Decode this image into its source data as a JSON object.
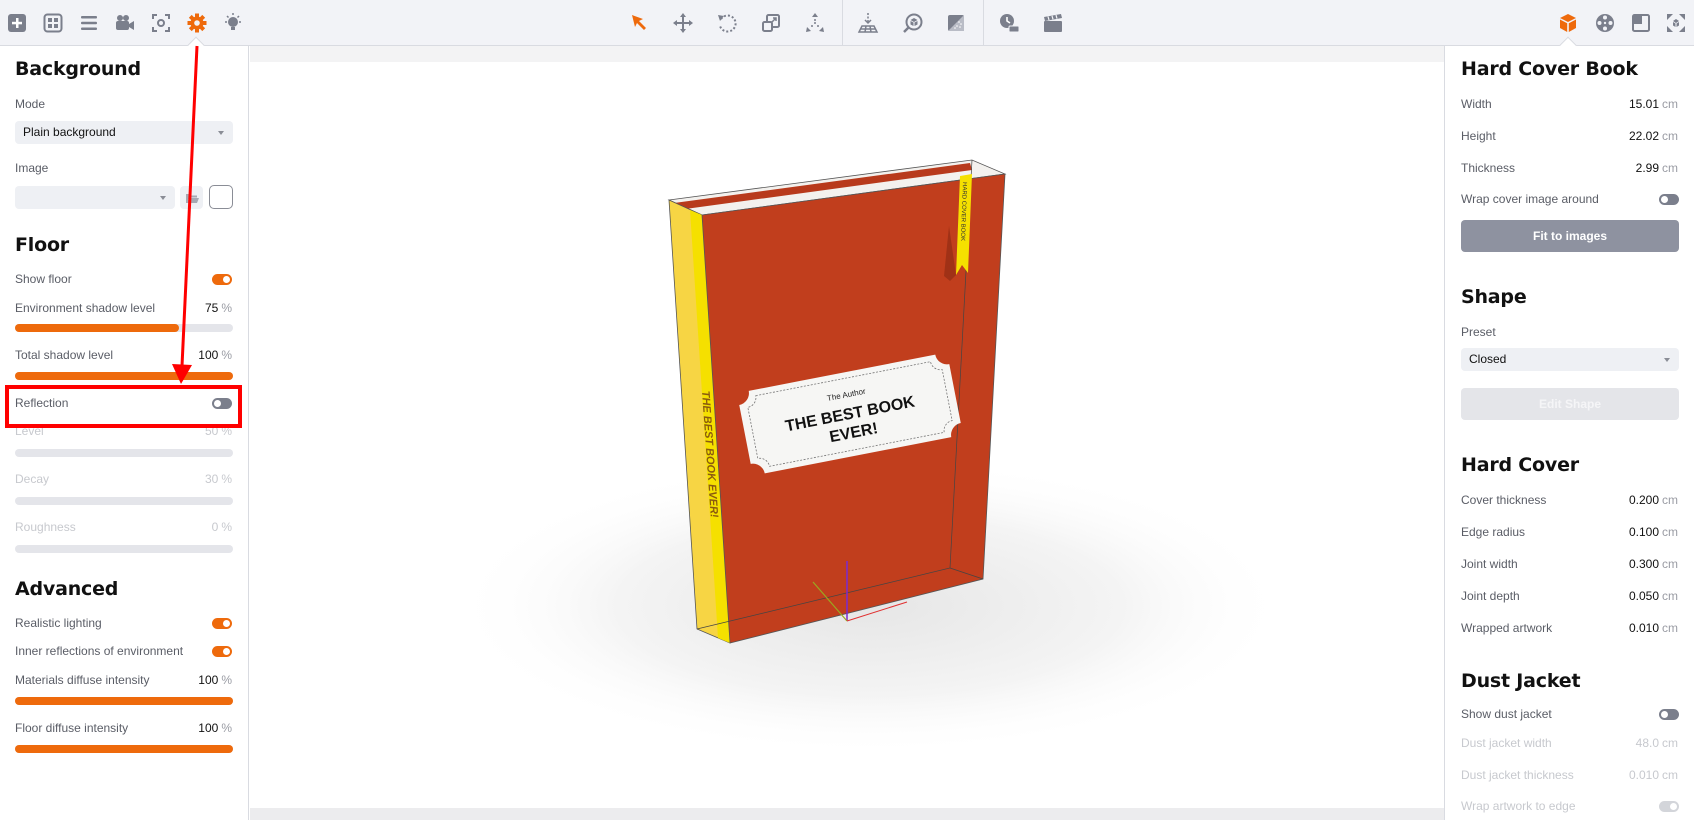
{
  "toolbar": {
    "left_icons": [
      {
        "name": "add-icon",
        "active": false
      },
      {
        "name": "grid-icon",
        "active": false
      },
      {
        "name": "list-icon",
        "active": false
      },
      {
        "name": "camera-icon",
        "active": false
      },
      {
        "name": "focus-icon",
        "active": false
      },
      {
        "name": "gear-icon",
        "active": true
      },
      {
        "name": "light-icon",
        "active": false
      }
    ],
    "center_icons": [
      {
        "name": "select-arrow-icon",
        "active": true
      },
      {
        "name": "move-icon",
        "active": false
      },
      {
        "name": "rotate-icon",
        "active": false
      },
      {
        "name": "scale-icon",
        "active": false
      },
      {
        "name": "axes-icon",
        "active": false
      },
      {
        "name": "drop-to-floor-icon",
        "active": false
      },
      {
        "name": "zoom-object-icon",
        "active": false
      },
      {
        "name": "material-icon",
        "active": false
      },
      {
        "name": "timer-icon",
        "active": false
      },
      {
        "name": "clapperboard-icon",
        "active": false
      }
    ],
    "right_icons": [
      {
        "name": "object-cube-icon",
        "active": true
      },
      {
        "name": "film-reel-icon",
        "active": false
      },
      {
        "name": "layout-icon",
        "active": false
      },
      {
        "name": "fullscreen-icon",
        "active": false
      }
    ],
    "accent_color": "#ee6a0c"
  },
  "left_panel": {
    "background": {
      "title": "Background",
      "mode_label": "Mode",
      "mode_value": "Plain background",
      "image_label": "Image",
      "image_value": ""
    },
    "floor": {
      "title": "Floor",
      "show_floor_label": "Show floor",
      "show_floor": true,
      "env_shadow_label": "Environment shadow level",
      "env_shadow_value": "75",
      "env_shadow_pct": 75,
      "total_shadow_label": "Total shadow level",
      "total_shadow_value": "100",
      "total_shadow_pct": 100,
      "reflection_label": "Reflection",
      "reflection": false,
      "level_label": "Level",
      "level_value": "50",
      "level_pct": 50,
      "decay_label": "Decay",
      "decay_value": "30",
      "decay_pct": 30,
      "roughness_label": "Roughness",
      "roughness_value": "0",
      "roughness_pct": 0,
      "unit": "%"
    },
    "advanced": {
      "title": "Advanced",
      "realistic_lighting_label": "Realistic lighting",
      "realistic_lighting": true,
      "inner_reflections_label": "Inner reflections of environment",
      "inner_reflections": true,
      "materials_diffuse_label": "Materials diffuse intensity",
      "materials_diffuse_value": "100",
      "materials_diffuse_pct": 100,
      "floor_diffuse_label": "Floor diffuse intensity",
      "floor_diffuse_value": "100",
      "floor_diffuse_pct": 100,
      "unit": "%"
    }
  },
  "viewport": {
    "book": {
      "author": "The Author",
      "title_line1": "THE BEST BOOK",
      "title_line2": "EVER!",
      "spine_text": "THE BEST BOOK EVER!",
      "bookmark_text": "HARD COVER BOOK",
      "cover_color": "#c13e1d",
      "spine_color": "#f5d02a"
    }
  },
  "right_panel": {
    "hard_cover_book": {
      "title": "Hard Cover Book",
      "rows": [
        {
          "label": "Width",
          "value": "15.01",
          "unit": "cm"
        },
        {
          "label": "Height",
          "value": "22.02",
          "unit": "cm"
        },
        {
          "label": "Thickness",
          "value": "2.99",
          "unit": "cm"
        }
      ],
      "wrap_label": "Wrap cover image around",
      "wrap": false,
      "fit_button": "Fit to images"
    },
    "shape": {
      "title": "Shape",
      "preset_label": "Preset",
      "preset_value": "Closed",
      "edit_button": "Edit Shape"
    },
    "hard_cover": {
      "title": "Hard Cover",
      "rows": [
        {
          "label": "Cover thickness",
          "value": "0.200",
          "unit": "cm"
        },
        {
          "label": "Edge radius",
          "value": "0.100",
          "unit": "cm"
        },
        {
          "label": "Joint width",
          "value": "0.300",
          "unit": "cm"
        },
        {
          "label": "Joint depth",
          "value": "0.050",
          "unit": "cm"
        },
        {
          "label": "Wrapped artwork",
          "value": "0.010",
          "unit": "cm"
        }
      ]
    },
    "dust_jacket": {
      "title": "Dust Jacket",
      "show_label": "Show dust jacket",
      "show": false,
      "width_label": "Dust jacket width",
      "width_value": "48.0",
      "thickness_label": "Dust jacket thickness",
      "thickness_value": "0.010",
      "unit": "cm",
      "wrap_label": "Wrap artwork to edge",
      "wrap": true
    }
  },
  "annotation": {
    "highlight_target": "Reflection",
    "color": "#ff0000"
  }
}
